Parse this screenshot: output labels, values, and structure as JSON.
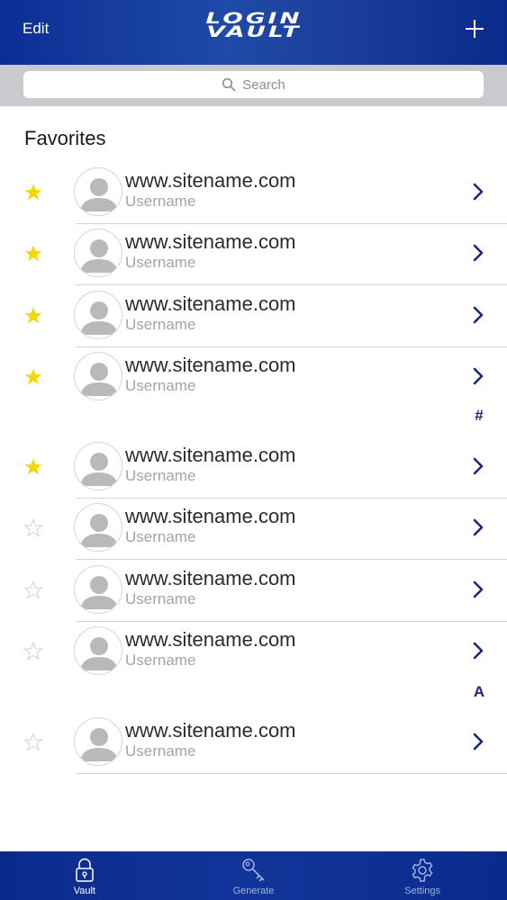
{
  "header": {
    "edit_label": "Edit",
    "logo_line1": "LOGIN",
    "logo_line2": "VAULT",
    "add_icon": "plus-icon"
  },
  "search": {
    "placeholder": "Search",
    "icon": "search-icon"
  },
  "favorites": {
    "title": "Favorites"
  },
  "entries": [
    {
      "site": "www.sitename.com",
      "username": "Username",
      "favorite": true
    },
    {
      "site": "www.sitename.com",
      "username": "Username",
      "favorite": true
    },
    {
      "site": "www.sitename.com",
      "username": "Username",
      "favorite": true
    },
    {
      "site": "www.sitename.com",
      "username": "Username",
      "favorite": true
    },
    {
      "site": "www.sitename.com",
      "username": "Username",
      "favorite": true
    },
    {
      "site": "www.sitename.com",
      "username": "Username",
      "favorite": false
    },
    {
      "site": "www.sitename.com",
      "username": "Username",
      "favorite": false
    },
    {
      "site": "www.sitename.com",
      "username": "Username",
      "favorite": false
    },
    {
      "site": "www.sitename.com",
      "username": "Username",
      "favorite": false
    }
  ],
  "index_letters": [
    "#",
    "A"
  ],
  "tabs": [
    {
      "label": "Vault",
      "icon": "lock-icon",
      "active": true
    },
    {
      "label": "Generate",
      "icon": "key-icon",
      "active": false
    },
    {
      "label": "Settings",
      "icon": "gear-icon",
      "active": false
    }
  ],
  "colors": {
    "brand_blue": "#0b2e95",
    "star_filled": "#f2d90b",
    "chevron": "#16297c"
  }
}
